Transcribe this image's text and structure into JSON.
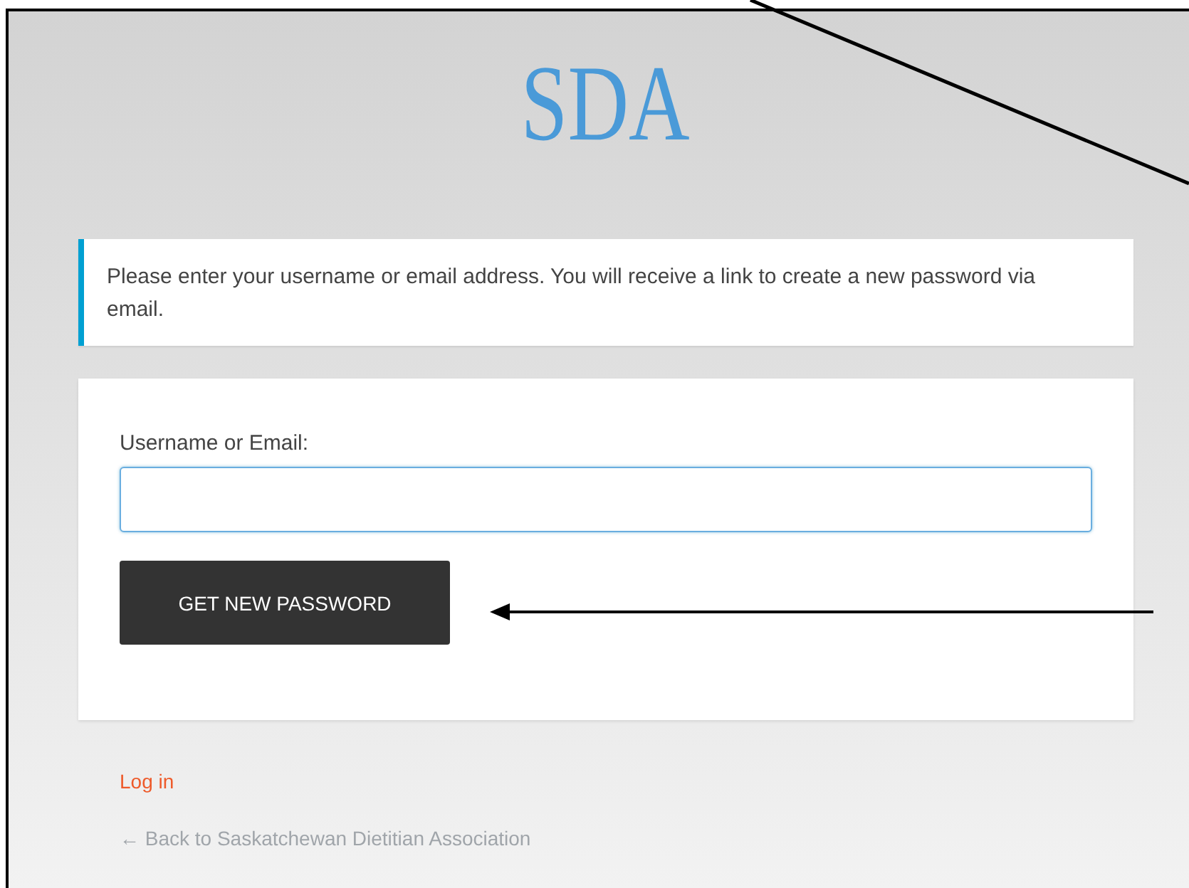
{
  "logo": {
    "text": "SDA"
  },
  "message": "Please enter your username or email address. You will receive a link to create a new password via email.",
  "form": {
    "label": "Username or Email:",
    "button": "GET NEW PASSWORD"
  },
  "links": [
    {
      "kind": "login",
      "text": "Log in"
    },
    {
      "kind": "back",
      "text": "← Back to Saskatchewan Dietitian Association"
    }
  ]
}
